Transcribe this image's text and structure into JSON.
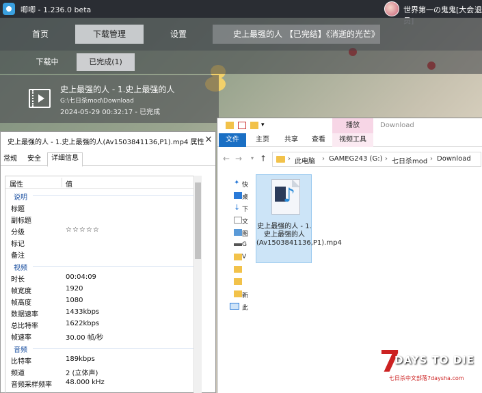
{
  "app": {
    "title": "唧唧 - 1.236.0 beta",
    "user": "世界第一の鬼鬼[大会员]",
    "user_more": "退",
    "nav": {
      "home": "首页",
      "download_manage": "下载管理",
      "settings": "设置",
      "video_title": "史上最强的人    【已完结】《消逝的光芒》"
    },
    "subtabs": {
      "downloading": "下载中",
      "completed": "已完成(1)"
    },
    "item": {
      "title": "史上最强的人 - 1.史上最强的人",
      "path": "G:\\七日杀mod\\Download",
      "time": "2024-05-29 00:32:17 - 已完成"
    }
  },
  "explorer": {
    "context_tab": "播放",
    "window_title": "Download",
    "ribbon": {
      "file": "文件",
      "home": "主页",
      "share": "共享",
      "view": "查看",
      "video_tools": "视频工具"
    },
    "breadcrumbs": [
      "此电脑",
      "GAMEG243 (G:)",
      "七日杀mod",
      "Download"
    ],
    "nav_items": [
      "快",
      "桌",
      "下",
      "文",
      "图",
      "G",
      "V",
      "　",
      "　",
      "新",
      "此"
    ],
    "file": {
      "name": "史上最强的人 - 1.史上最强的人(Av1503841136,P1).mp4"
    }
  },
  "props": {
    "title": "史上最强的人 - 1.史上最强的人(Av1503841136,P1).mp4 属性",
    "close": "×",
    "tabs": {
      "general": "常规",
      "security": "安全",
      "details": "详细信息"
    },
    "headers": {
      "property": "属性",
      "value": "值"
    },
    "sections": {
      "description": "说明",
      "video": "视频",
      "audio": "音频"
    },
    "description": [
      {
        "k": "标题",
        "v": ""
      },
      {
        "k": "副标题",
        "v": ""
      },
      {
        "k": "分级",
        "v": "☆☆☆☆☆"
      },
      {
        "k": "标记",
        "v": ""
      },
      {
        "k": "备注",
        "v": ""
      }
    ],
    "video": [
      {
        "k": "时长",
        "v": "00:04:09"
      },
      {
        "k": "帧宽度",
        "v": "1920"
      },
      {
        "k": "帧高度",
        "v": "1080"
      },
      {
        "k": "数据速率",
        "v": "1433kbps"
      },
      {
        "k": "总比特率",
        "v": "1622kbps"
      },
      {
        "k": "帧速率",
        "v": "30.00 帧/秒"
      }
    ],
    "audio": [
      {
        "k": "比特率",
        "v": "189kbps"
      },
      {
        "k": "频道",
        "v": "2 (立体声)"
      },
      {
        "k": "音频采样频率",
        "v": "48.000 kHz"
      }
    ]
  },
  "watermark": {
    "big": "7",
    "text": "DAYS TO DIE",
    "sub": "七日杀中文部落7daysha.com"
  }
}
